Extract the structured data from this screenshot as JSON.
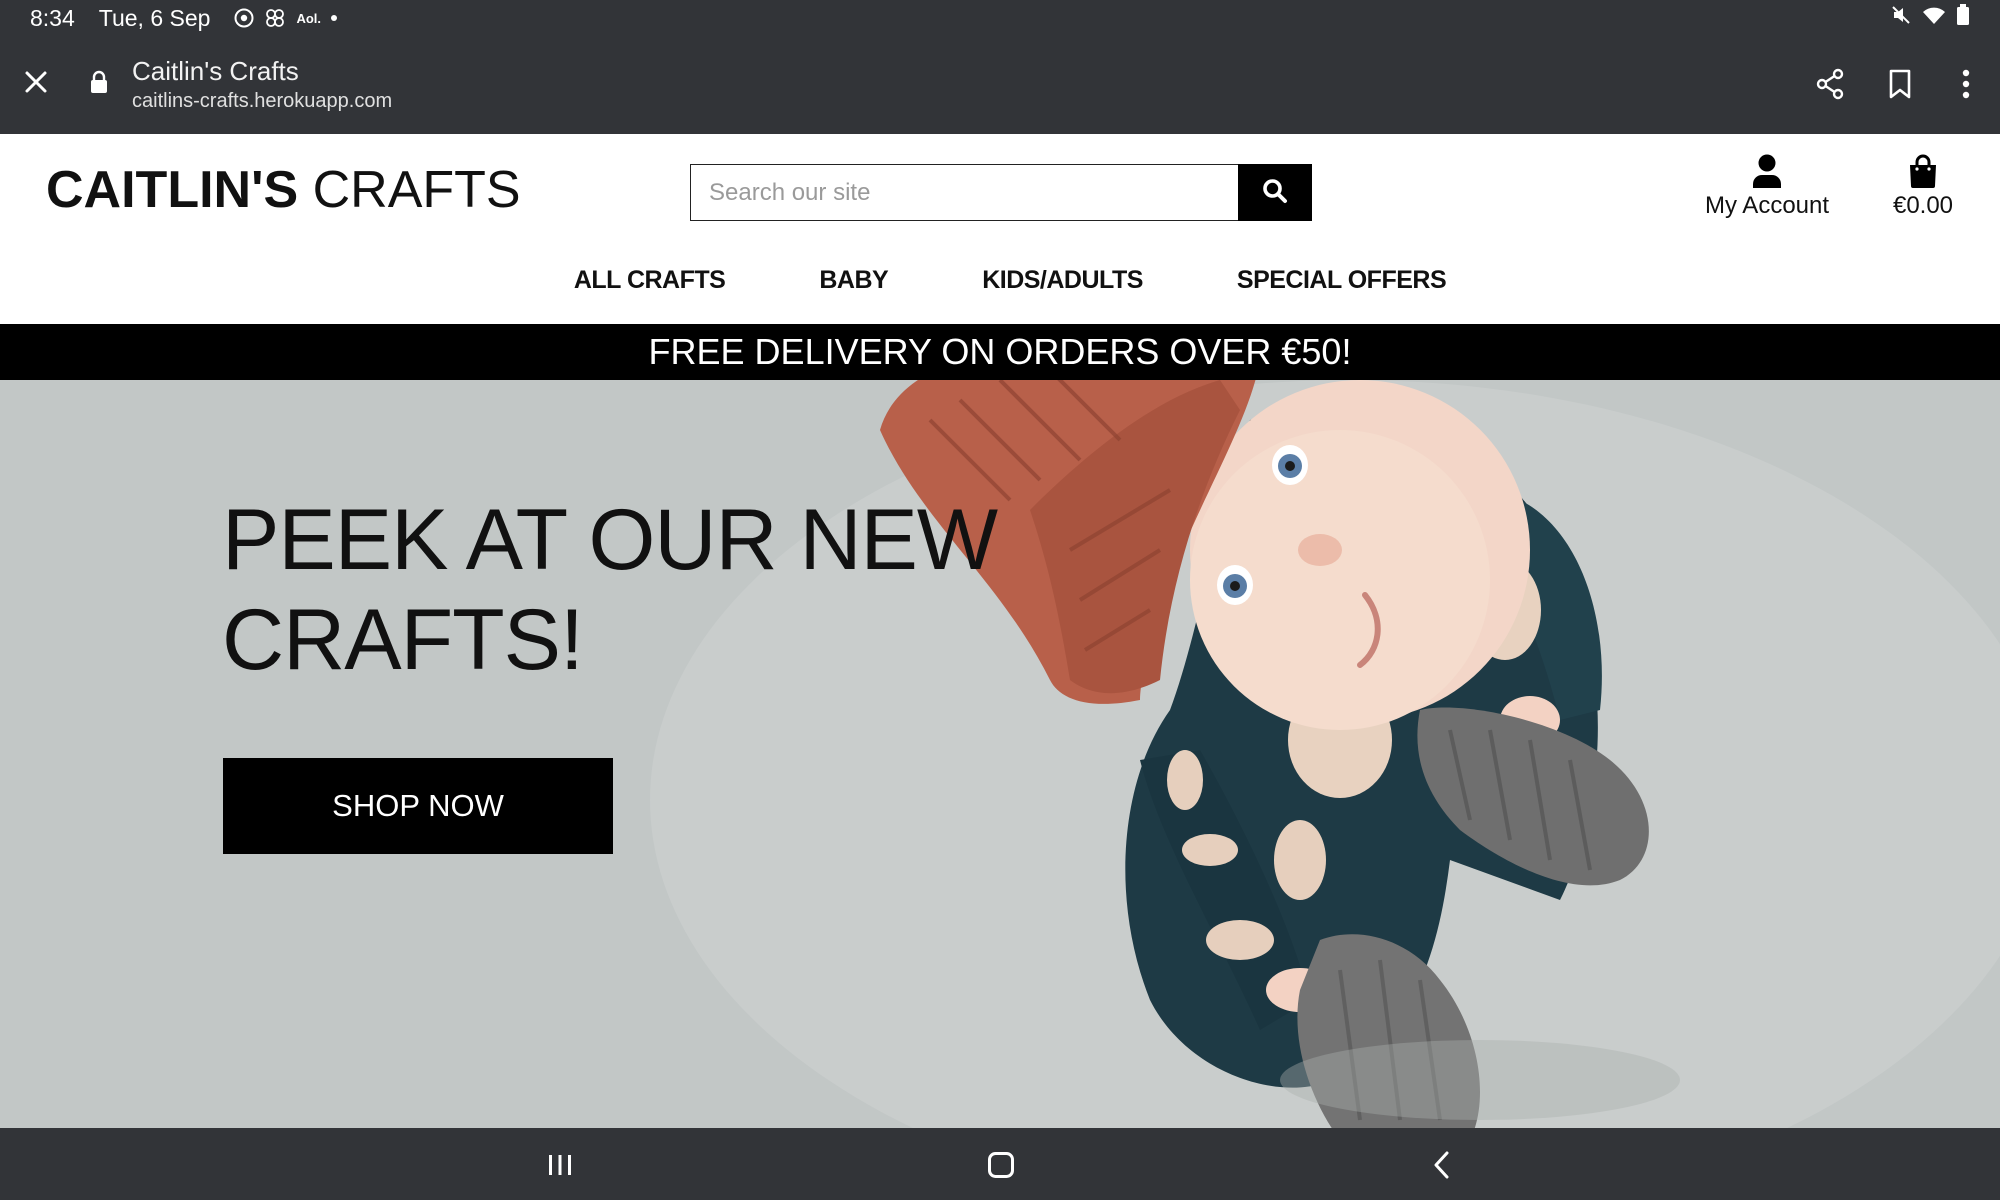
{
  "status_bar": {
    "time": "8:34",
    "date": "Tue, 6 Sep",
    "notification_icons": [
      "chrome-icon",
      "pinwheel-icon",
      "aol-icon",
      "more-notifications-dot-icon"
    ],
    "aol_label": "Aol.",
    "system_icons": [
      "mute-icon",
      "wifi-icon",
      "battery-icon"
    ]
  },
  "browser": {
    "page_title": "Caitlin's Crafts",
    "url": "caitlins-crafts.herokuapp.com",
    "icons": [
      "close-icon",
      "lock-icon",
      "share-icon",
      "bookmark-icon",
      "more-vertical-icon"
    ]
  },
  "header": {
    "logo_bold": "CAITLIN'S",
    "logo_light": " CRAFTS",
    "search_placeholder": "Search our site",
    "search_value": "",
    "account_label": "My Account",
    "cart_total": "€0.00"
  },
  "nav": {
    "items": [
      {
        "label": "ALL CRAFTS"
      },
      {
        "label": "BABY"
      },
      {
        "label": "KIDS/ADULTS"
      },
      {
        "label": "SPECIAL OFFERS"
      }
    ]
  },
  "promo": {
    "text": "FREE DELIVERY ON ORDERS OVER €50!"
  },
  "hero": {
    "heading_line1": "PEEK AT OUR NEW",
    "heading_line2": "CRAFTS!",
    "cta_label": "SHOP NOW"
  },
  "system_nav": {
    "icons": [
      "recents-icon",
      "home-icon",
      "back-icon"
    ]
  },
  "colors": {
    "chrome_bar": "#323438",
    "promo_bg": "#000000",
    "hero_bg": "#c3c8c7",
    "cta_bg": "#000000",
    "hat": "#b8604a",
    "outfit": "#1e3a45"
  }
}
